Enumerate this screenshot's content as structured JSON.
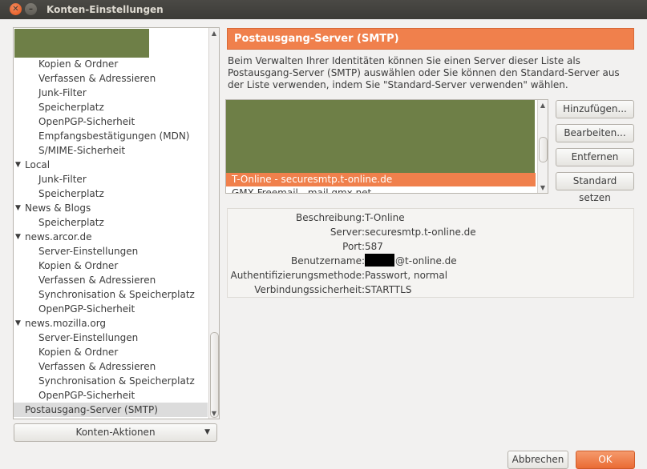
{
  "window": {
    "title": "Konten-Einstellungen"
  },
  "tree": {
    "items": [
      {
        "label": "Kopien & Ordner",
        "level": 2
      },
      {
        "label": "Verfassen & Adressieren",
        "level": 2
      },
      {
        "label": "Junk-Filter",
        "level": 2
      },
      {
        "label": "Speicherplatz",
        "level": 2
      },
      {
        "label": "OpenPGP-Sicherheit",
        "level": 2
      },
      {
        "label": "Empfangsbestätigungen (MDN)",
        "level": 2
      },
      {
        "label": "S/MIME-Sicherheit",
        "level": 2
      },
      {
        "label": "Local",
        "level": 1
      },
      {
        "label": "Junk-Filter",
        "level": 2
      },
      {
        "label": "Speicherplatz",
        "level": 2
      },
      {
        "label": "News & Blogs",
        "level": 1
      },
      {
        "label": "Speicherplatz",
        "level": 2
      },
      {
        "label": "news.arcor.de",
        "level": 1
      },
      {
        "label": "Server-Einstellungen",
        "level": 2
      },
      {
        "label": "Kopien & Ordner",
        "level": 2
      },
      {
        "label": "Verfassen & Adressieren",
        "level": 2
      },
      {
        "label": "Synchronisation & Speicherplatz",
        "level": 2
      },
      {
        "label": "OpenPGP-Sicherheit",
        "level": 2
      },
      {
        "label": "news.mozilla.org",
        "level": 1
      },
      {
        "label": "Server-Einstellungen",
        "level": 2
      },
      {
        "label": "Kopien & Ordner",
        "level": 2
      },
      {
        "label": "Verfassen & Adressieren",
        "level": 2
      },
      {
        "label": "Synchronisation & Speicherplatz",
        "level": 2
      },
      {
        "label": "OpenPGP-Sicherheit",
        "level": 2
      },
      {
        "label": "Postausgang-Server (SMTP)",
        "level": 0,
        "selected": true
      }
    ]
  },
  "account_actions_label": "Konten-Aktionen",
  "panel": {
    "title": "Postausgang-Server (SMTP)",
    "description": "Beim Verwalten Ihrer Identitäten können Sie einen Server dieser Liste als Postausgang-Server (SMTP) auswählen oder Sie können den Standard-Server aus der Liste verwenden, indem Sie \"Standard-Server verwenden\" wählen.",
    "servers": {
      "selected": "T-Online - securesmtp.t-online.de",
      "partial": "GMX Freemail - mail.gmx.net"
    },
    "buttons": {
      "add": "Hinzufügen...",
      "edit": "Bearbeiten...",
      "remove": "Entfernen",
      "set_default": "Standard setzen"
    },
    "details": {
      "description_label": "Beschreibung:",
      "description_value": "T-Online",
      "server_label": "Server:",
      "server_value": "securesmtp.t-online.de",
      "port_label": "Port:",
      "port_value": "587",
      "username_label": "Benutzername:",
      "username_value": "@t-online.de",
      "auth_label": "Authentifizierungsmethode:",
      "auth_value": "Passwort, normal",
      "security_label": "Verbindungssicherheit:",
      "security_value": "STARTTLS"
    }
  },
  "dialog_buttons": {
    "cancel": "Abbrechen",
    "ok": "OK"
  }
}
